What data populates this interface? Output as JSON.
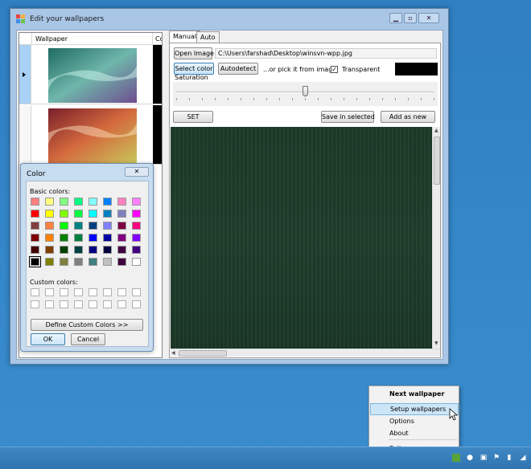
{
  "window": {
    "title": "Edit your wallpapers",
    "controls": {
      "minimize": "▁",
      "maximize": "▫",
      "close": "✕"
    }
  },
  "list": {
    "columns": [
      "Wallpaper",
      "Cc"
    ],
    "rows": [
      {
        "selected": true,
        "thumb": "teal-wave"
      },
      {
        "selected": false,
        "thumb": "red-yellow-wave"
      }
    ]
  },
  "tabs": [
    {
      "label": "Manual",
      "active": true
    },
    {
      "label": "Auto",
      "active": false
    }
  ],
  "manual": {
    "open_image_label": "Open Image",
    "path_value": "C:\\Users\\farshad\\Desktop\\winsvn-wpp.jpg",
    "select_color_label": "Select color",
    "autodetect_label": "Autodetect",
    "pick_hint": "...or pick it from image",
    "transparent_label": "Transparent",
    "transparent_checked": true,
    "selected_color": "#000000",
    "saturation_label": "Saturation",
    "saturation_value": 0.5,
    "set_label": "SET",
    "save_selected_label": "Save in selected",
    "add_new_label": "Add as new"
  },
  "color_dialog": {
    "title": "Color",
    "close_label": "✕",
    "basic_label": "Basic colors:",
    "basic_colors": [
      "#ff8080",
      "#ffff80",
      "#80ff80",
      "#00ff80",
      "#80ffff",
      "#0080ff",
      "#ff80c0",
      "#ff80ff",
      "#ff0000",
      "#ffff00",
      "#80ff00",
      "#00ff40",
      "#00ffff",
      "#0080c0",
      "#8080c0",
      "#ff00ff",
      "#804040",
      "#ff8040",
      "#00ff00",
      "#008080",
      "#004080",
      "#8080ff",
      "#800040",
      "#ff0080",
      "#800000",
      "#ff8000",
      "#008000",
      "#008040",
      "#0000ff",
      "#0000a0",
      "#800080",
      "#8000ff",
      "#400000",
      "#804000",
      "#004000",
      "#004040",
      "#000080",
      "#000040",
      "#400040",
      "#400080",
      "#000000",
      "#808000",
      "#808040",
      "#808080",
      "#408080",
      "#c0c0c0",
      "#400040",
      "#ffffff"
    ],
    "current_index": 40,
    "custom_label": "Custom colors:",
    "define_label": "Define Custom Colors >>",
    "ok_label": "OK",
    "cancel_label": "Cancel"
  },
  "context_menu": {
    "items": [
      {
        "label": "Next wallpaper",
        "bold": true
      },
      {
        "label": "Setup wallpapers",
        "highlight": true
      },
      {
        "label": "Options"
      },
      {
        "label": "About"
      },
      {
        "label": "Exit"
      }
    ]
  },
  "taskbar": {
    "tray_icons": [
      "wallpaper-tray-icon",
      "chat-icon",
      "display-icon",
      "flag-icon",
      "network-icon",
      "signal-icon"
    ]
  }
}
